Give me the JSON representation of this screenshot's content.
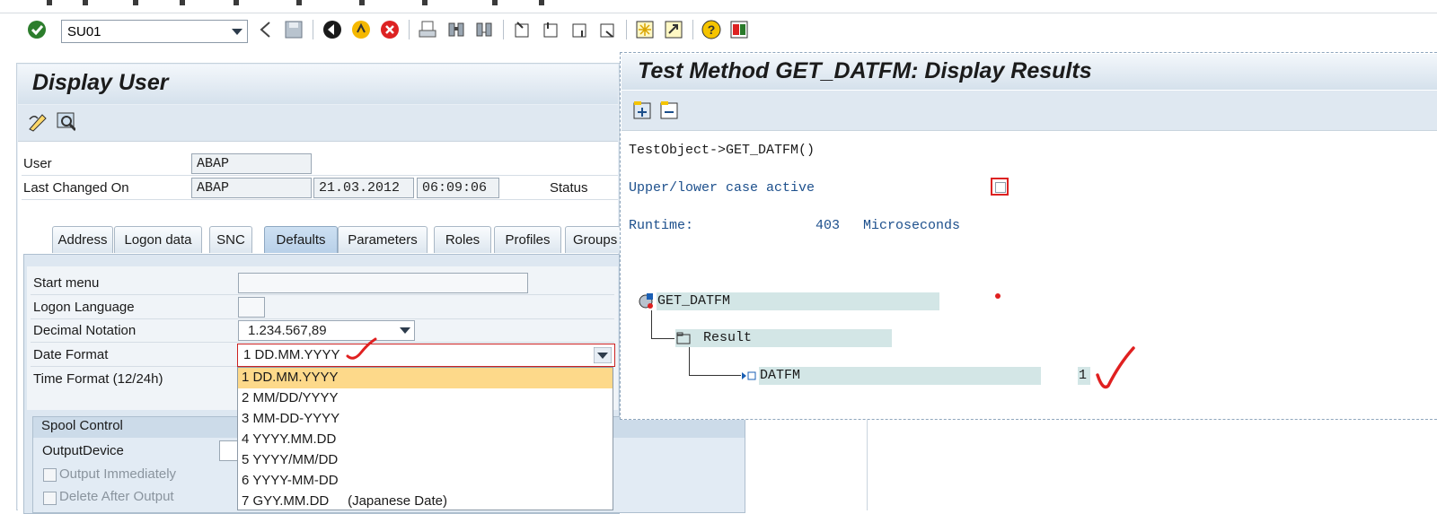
{
  "toolbar": {
    "command_field": "SU01",
    "icons": [
      "enter-icon",
      "back-icon",
      "save-icon",
      "back-green-icon",
      "exit-icon",
      "cancel-icon",
      "print-icon",
      "find-icon",
      "find-next-icon",
      "first-page-icon",
      "prev-page-icon",
      "next-page-icon",
      "last-page-icon",
      "new-session-icon",
      "shortcut-icon",
      "help-icon",
      "layout-icon"
    ]
  },
  "display_user": {
    "title": "Display User",
    "tool_icons": [
      "change-icon",
      "other-user-icon"
    ],
    "user_label": "User",
    "user_value": "ABAP",
    "last_changed_label": "Last Changed On",
    "last_changed_by": "ABAP",
    "last_changed_date": "21.03.2012",
    "last_changed_time": "06:09:06",
    "status_label": "Status",
    "tabs": [
      "Address",
      "Logon data",
      "SNC",
      "Defaults",
      "Parameters",
      "Roles",
      "Profiles",
      "Groups"
    ],
    "active_tab": "Defaults",
    "defaults": {
      "start_menu_label": "Start menu",
      "start_menu_value": "",
      "logon_language_label": "Logon Language",
      "logon_language_value": "",
      "decimal_notation_label": "Decimal Notation",
      "decimal_notation_value": "1.234.567,89",
      "date_format_label": "Date Format",
      "date_format_value": "1 DD.MM.YYYY",
      "time_format_label": "Time Format (12/24h)"
    },
    "spool": {
      "title": "Spool Control",
      "output_device_label": "OutputDevice",
      "output_immediately_label": "Output Immediately",
      "delete_after_output_label": "Delete After Output"
    },
    "date_format_options": [
      "1 DD.MM.YYYY",
      "2 MM/DD/YYYY",
      "3 MM-DD-YYYY",
      "4 YYYY.MM.DD",
      "5 YYYY/MM/DD",
      "6 YYYY-MM-DD",
      "7 GYY.MM.DD     (Japanese Date)"
    ],
    "selected_option": "1 DD.MM.YYYY"
  },
  "test_method": {
    "title": "Test Method GET_DATFM: Display Results",
    "tool_icons": [
      "expand-all-icon",
      "collapse-all-icon"
    ],
    "call_line": "TestObject->GET_DATFM()",
    "case_label": "Upper/lower case active",
    "case_checked": false,
    "runtime_label": "Runtime:",
    "runtime_value": "403",
    "runtime_unit": "Microseconds",
    "tree": {
      "root": "GET_DATFM",
      "result_node": "Result",
      "param_name": "DATFM",
      "param_value": "1"
    }
  },
  "colors": {
    "panel_header": "#d5e1ec",
    "selection": "#fdd98a",
    "annotation": "#e02020",
    "tree_highlight": "#d3e6e6"
  }
}
